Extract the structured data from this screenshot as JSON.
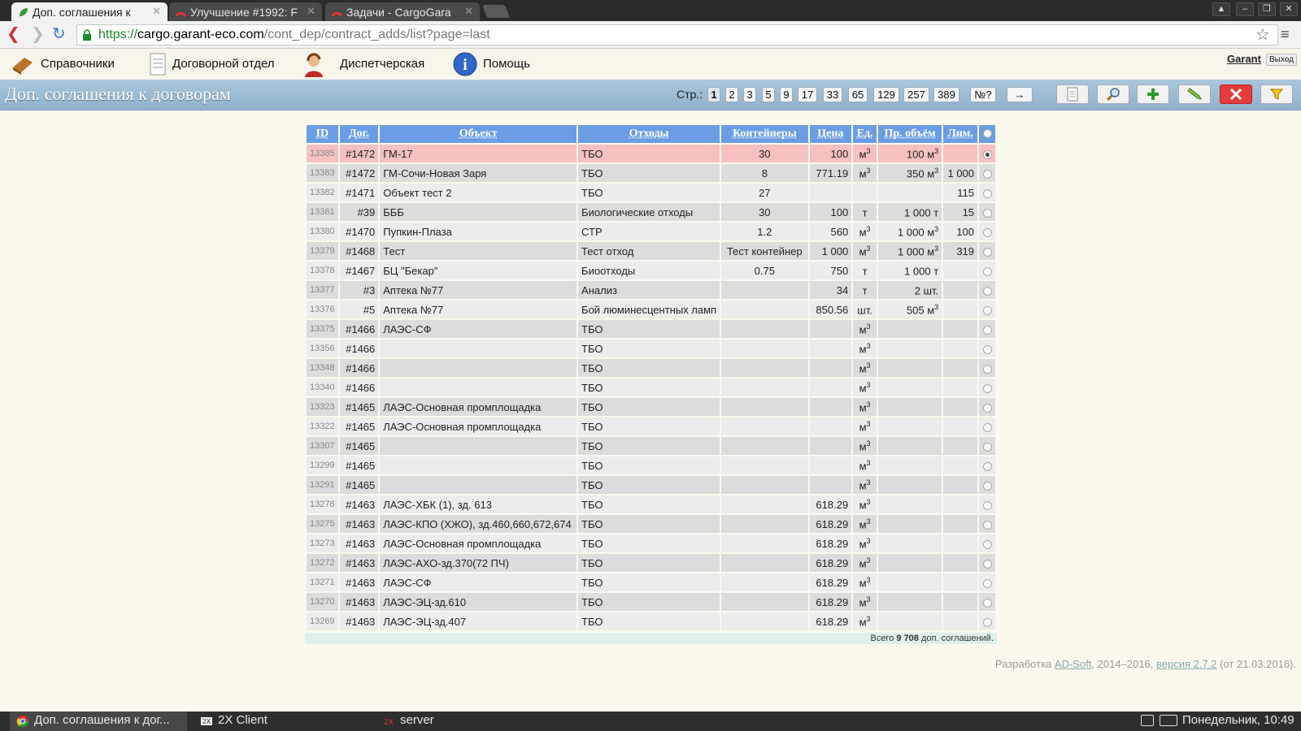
{
  "browser": {
    "tabs": [
      {
        "title": "Доп. соглашения к",
        "active": true
      },
      {
        "title": "Улучшение #1992: F",
        "active": false
      },
      {
        "title": "Задачи - CargoGara",
        "active": false
      }
    ],
    "url_scheme": "https://",
    "url_host": "cargo.garant-eco.com",
    "url_path": "/cont_dep/contract_adds/list?page=last"
  },
  "menu": {
    "items": [
      "Справочники",
      "Договорной отдел",
      "Диспетчерская",
      "Помощь"
    ],
    "user": "Garant",
    "logout": "Выход"
  },
  "page": {
    "title": "Доп. соглашения к договорам",
    "pages_label": "Стр.:",
    "pages": [
      "1",
      "2",
      "3",
      "5",
      "9",
      "17",
      "33",
      "65",
      "129",
      "257",
      "389",
      "№?",
      "→"
    ],
    "current_page": "1"
  },
  "table": {
    "headers": [
      "ID",
      "Дог.",
      "Объект",
      "Отходы",
      "Контейнеры",
      "Цена",
      "Ед.",
      "Пр. объём",
      "Лим."
    ],
    "rows": [
      {
        "id": "13385",
        "dog": "#1472",
        "obj": "ГМ-17",
        "waste": "ТБО",
        "cont": "30",
        "price": "100",
        "unit": "м",
        "unit_sup": "3",
        "vol": "100 м",
        "vol_sup": "3",
        "lim": "",
        "selected": true
      },
      {
        "id": "13383",
        "dog": "#1472",
        "obj": "ГМ-Сочи-Новая Заря",
        "waste": "ТБО",
        "cont": "8",
        "price": "771.19",
        "unit": "м",
        "unit_sup": "3",
        "vol": "350 м",
        "vol_sup": "3",
        "lim": "1 000"
      },
      {
        "id": "13382",
        "dog": "#1471",
        "obj": "Объект тест 2",
        "waste": "ТБО",
        "cont": "27",
        "price": "",
        "unit": "",
        "unit_sup": "",
        "vol": "",
        "vol_sup": "",
        "lim": "115"
      },
      {
        "id": "13381",
        "dog": "#39",
        "obj": "БББ",
        "waste": "Биологические отходы",
        "cont": "30",
        "price": "100",
        "unit": "т",
        "unit_sup": "",
        "vol": "1 000 т",
        "vol_sup": "",
        "lim": "15"
      },
      {
        "id": "13380",
        "dog": "#1470",
        "obj": "Пупкин-Плаза",
        "waste": "СТР",
        "cont": "1.2",
        "price": "560",
        "unit": "м",
        "unit_sup": "3",
        "vol": "1 000 м",
        "vol_sup": "3",
        "lim": "100"
      },
      {
        "id": "13379",
        "dog": "#1468",
        "obj": "Тест",
        "waste": "Тест отход",
        "cont": "Тест контейнер",
        "price": "1 000",
        "unit": "м",
        "unit_sup": "3",
        "vol": "1 000 м",
        "vol_sup": "3",
        "lim": "319"
      },
      {
        "id": "13378",
        "dog": "#1467",
        "obj": "БЦ \"Бекар\"",
        "waste": "Биоотходы",
        "cont": "0.75",
        "price": "750",
        "unit": "т",
        "unit_sup": "",
        "vol": "1 000 т",
        "vol_sup": "",
        "lim": ""
      },
      {
        "id": "13377",
        "dog": "#3",
        "obj": "Аптека №77",
        "waste": "Анализ",
        "cont": "",
        "price": "34",
        "unit": "т",
        "unit_sup": "",
        "vol": "2 шт.",
        "vol_sup": "",
        "lim": ""
      },
      {
        "id": "13376",
        "dog": "#5",
        "obj": "Аптека №77",
        "waste": "Бой люминесцентных ламп",
        "cont": "",
        "price": "850.56",
        "unit": "шт.",
        "unit_sup": "",
        "vol": "505 м",
        "vol_sup": "3",
        "lim": ""
      },
      {
        "id": "13375",
        "dog": "#1466",
        "obj": "ЛАЭС-СФ",
        "waste": "ТБО",
        "cont": "",
        "price": "",
        "unit": "м",
        "unit_sup": "3",
        "vol": "",
        "vol_sup": "",
        "lim": ""
      },
      {
        "id": "13356",
        "dog": "#1466",
        "obj": "",
        "waste": "ТБО",
        "cont": "",
        "price": "",
        "unit": "м",
        "unit_sup": "3",
        "vol": "",
        "vol_sup": "",
        "lim": ""
      },
      {
        "id": "13348",
        "dog": "#1466",
        "obj": "",
        "waste": "ТБО",
        "cont": "",
        "price": "",
        "unit": "м",
        "unit_sup": "3",
        "vol": "",
        "vol_sup": "",
        "lim": ""
      },
      {
        "id": "13340",
        "dog": "#1466",
        "obj": "",
        "waste": "ТБО",
        "cont": "",
        "price": "",
        "unit": "м",
        "unit_sup": "3",
        "vol": "",
        "vol_sup": "",
        "lim": ""
      },
      {
        "id": "13323",
        "dog": "#1465",
        "obj": "ЛАЭС-Основная промплощадка",
        "waste": "ТБО",
        "cont": "",
        "price": "",
        "unit": "м",
        "unit_sup": "3",
        "vol": "",
        "vol_sup": "",
        "lim": ""
      },
      {
        "id": "13322",
        "dog": "#1465",
        "obj": "ЛАЭС-Основная промплощадка",
        "waste": "ТБО",
        "cont": "",
        "price": "",
        "unit": "м",
        "unit_sup": "3",
        "vol": "",
        "vol_sup": "",
        "lim": ""
      },
      {
        "id": "13307",
        "dog": "#1465",
        "obj": "",
        "waste": "ТБО",
        "cont": "",
        "price": "",
        "unit": "м",
        "unit_sup": "3",
        "vol": "",
        "vol_sup": "",
        "lim": ""
      },
      {
        "id": "13299",
        "dog": "#1465",
        "obj": "",
        "waste": "ТБО",
        "cont": "",
        "price": "",
        "unit": "м",
        "unit_sup": "3",
        "vol": "",
        "vol_sup": "",
        "lim": ""
      },
      {
        "id": "13291",
        "dog": "#1465",
        "obj": "",
        "waste": "ТБО",
        "cont": "",
        "price": "",
        "unit": "м",
        "unit_sup": "3",
        "vol": "",
        "vol_sup": "",
        "lim": ""
      },
      {
        "id": "13276",
        "dog": "#1463",
        "obj": "ЛАЭС-ХБК (1), зд. 613",
        "waste": "ТБО",
        "cont": "",
        "price": "618.29",
        "unit": "м",
        "unit_sup": "3",
        "vol": "",
        "vol_sup": "",
        "lim": ""
      },
      {
        "id": "13275",
        "dog": "#1463",
        "obj": "ЛАЭС-КПО (ХЖО), зд.460,660,672,674",
        "waste": "ТБО",
        "cont": "",
        "price": "618.29",
        "unit": "м",
        "unit_sup": "3",
        "vol": "",
        "vol_sup": "",
        "lim": ""
      },
      {
        "id": "13273",
        "dog": "#1463",
        "obj": "ЛАЭС-Основная промплощадка",
        "waste": "ТБО",
        "cont": "",
        "price": "618.29",
        "unit": "м",
        "unit_sup": "3",
        "vol": "",
        "vol_sup": "",
        "lim": ""
      },
      {
        "id": "13272",
        "dog": "#1463",
        "obj": "ЛАЭС-АХО-зд.370(72 ПЧ)",
        "waste": "ТБО",
        "cont": "",
        "price": "618.29",
        "unit": "м",
        "unit_sup": "3",
        "vol": "",
        "vol_sup": "",
        "lim": ""
      },
      {
        "id": "13271",
        "dog": "#1463",
        "obj": "ЛАЭС-СФ",
        "waste": "ТБО",
        "cont": "",
        "price": "618.29",
        "unit": "м",
        "unit_sup": "3",
        "vol": "",
        "vol_sup": "",
        "lim": ""
      },
      {
        "id": "13270",
        "dog": "#1463",
        "obj": "ЛАЭС-ЭЦ-зд.610",
        "waste": "ТБО",
        "cont": "",
        "price": "618.29",
        "unit": "м",
        "unit_sup": "3",
        "vol": "",
        "vol_sup": "",
        "lim": ""
      },
      {
        "id": "13269",
        "dog": "#1463",
        "obj": "ЛАЭС-ЭЦ-зд.407",
        "waste": "ТБО",
        "cont": "",
        "price": "618.29",
        "unit": "м",
        "unit_sup": "3",
        "vol": "",
        "vol_sup": "",
        "lim": ""
      }
    ],
    "total_prefix": "Всего",
    "total_count": "9 708",
    "total_suffix": "доп. соглашений."
  },
  "footer": {
    "prefix": "Разработка",
    "company": "AD-Soft",
    "years": ", 2014–2016,",
    "version_link": "версия 2.7.2",
    "date": "(от 21.03.2016)."
  },
  "taskbar": {
    "items": [
      "Доп. соглашения к дог...",
      "2X Client",
      "server"
    ],
    "clock": "Понедельник, 10:49"
  },
  "colors": {
    "header_blue": "#6a9de3",
    "title_band": "#9dbdd3",
    "selected_row": "#f6c0c0",
    "delete_red": "#e43b3b"
  }
}
